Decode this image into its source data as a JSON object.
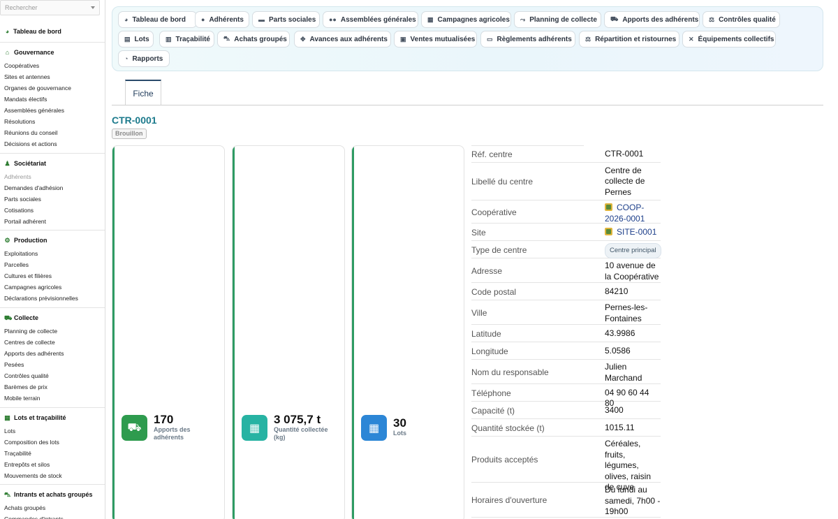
{
  "sidebar": {
    "search_placeholder": "Rechercher",
    "dashboard": "Tableau de bord",
    "sections": [
      {
        "title": "Gouvernance",
        "icon": "bank-icon",
        "items": [
          "Coopératives",
          "Sites et antennes",
          "Organes de gouvernance",
          "Mandats électifs",
          "Assemblées générales",
          "Résolutions",
          "Réunions du conseil",
          "Décisions et actions"
        ]
      },
      {
        "title": "Sociétariat",
        "icon": "member-icon",
        "items": [
          "Adhérents",
          "Demandes d'adhésion",
          "Parts sociales",
          "Cotisations",
          "Portail adhérent"
        ]
      },
      {
        "title": "Production",
        "icon": "tractor-icon",
        "items": [
          "Exploitations",
          "Parcelles",
          "Cultures et filières",
          "Campagnes agricoles",
          "Déclarations prévisionnelles"
        ]
      },
      {
        "title": "Collecte",
        "icon": "collect-icon",
        "items": [
          "Planning de collecte",
          "Centres de collecte",
          "Apports des adhérents",
          "Pesées",
          "Contrôles qualité",
          "Barèmes de prix",
          "Mobile terrain"
        ]
      },
      {
        "title": "Lots et traçabilité",
        "icon": "boxes-icon",
        "items": [
          "Lots",
          "Composition des lots",
          "Traçabilité",
          "Entrepôts et silos",
          "Mouvements de stock"
        ]
      },
      {
        "title": "Intrants et achats groupés",
        "icon": "cart-icon",
        "items": [
          "Achats groupés",
          "Commandes d'intrants"
        ]
      }
    ]
  },
  "toolbar": {
    "buttons": [
      {
        "label": "Tableau de bord",
        "icon": "gauge-icon"
      },
      {
        "label": "Adhérents",
        "icon": "user-icon"
      },
      {
        "label": "Parts sociales",
        "icon": "ticket-icon"
      },
      {
        "label": "Assemblées générales",
        "icon": "users-icon"
      },
      {
        "label": "Campagnes agricoles",
        "icon": "calendar-icon"
      },
      {
        "label": "Planning de collecte",
        "icon": "route-icon"
      },
      {
        "label": "Apports des adhérents",
        "icon": "truck-icon"
      },
      {
        "label": "Contrôles qualité",
        "icon": "scale-icon"
      },
      {
        "label": "Lots",
        "icon": "pallet-icon"
      },
      {
        "label": "Traçabilité",
        "icon": "barcode-icon"
      },
      {
        "label": "Achats groupés",
        "icon": "cart-icon"
      },
      {
        "label": "Avances aux adhérents",
        "icon": "handshake-icon"
      },
      {
        "label": "Ventes mutualisées",
        "icon": "store-icon"
      },
      {
        "label": "Règlements adhérents",
        "icon": "money-icon"
      },
      {
        "label": "Répartition et ristournes",
        "icon": "balance-icon"
      },
      {
        "label": "Équipements collectifs",
        "icon": "tools-icon"
      },
      {
        "label": "Rapports",
        "icon": "chart-pie-icon"
      }
    ]
  },
  "tabs": [
    "Fiche"
  ],
  "record": {
    "ref": "CTR-0001",
    "status": "Brouillon"
  },
  "kpis": [
    {
      "value": "170",
      "label": "Apports des adhérents",
      "icon": "truck-loading-icon",
      "color": "#2e9b4e"
    },
    {
      "value": "3 075,7 t",
      "label": "Quantité collectée (kg)",
      "icon": "boxes-icon",
      "color": "#27b3a3"
    },
    {
      "value": "30",
      "label": "Lots",
      "icon": "pallets-icon",
      "color": "#2c86d6"
    }
  ],
  "details": [
    {
      "key": "Réf. centre",
      "value": "CTR-0001"
    },
    {
      "key": "Libellé du centre",
      "value": "Centre de collecte de Pernes"
    },
    {
      "key": "Coopérative",
      "value": "COOP-2026-0001",
      "type": "link"
    },
    {
      "key": "Site",
      "value": "SITE-0001",
      "type": "link"
    },
    {
      "key": "Type de centre",
      "value": "Centre principal",
      "type": "pill"
    },
    {
      "key": "Adresse",
      "value": "10 avenue de la Coopérative"
    },
    {
      "key": "Code postal",
      "value": "84210"
    },
    {
      "key": "Ville",
      "value": "Pernes-les-Fontaines"
    },
    {
      "key": "Latitude",
      "value": "43.9986"
    },
    {
      "key": "Longitude",
      "value": "5.0586"
    },
    {
      "key": "Nom du responsable",
      "value": "Julien Marchand"
    },
    {
      "key": "Téléphone",
      "value": "04 90 60 44 80"
    },
    {
      "key": "Capacité (t)",
      "value": "3400"
    },
    {
      "key": "Quantité stockée (t)",
      "value": "1015.11"
    },
    {
      "key": "Produits acceptés",
      "value": "Céréales, fruits, légumes, olives, raisin de cuve"
    },
    {
      "key": "Horaires d'ouverture",
      "value": "Du lundi au samedi, 7h00 - 19h00"
    }
  ]
}
